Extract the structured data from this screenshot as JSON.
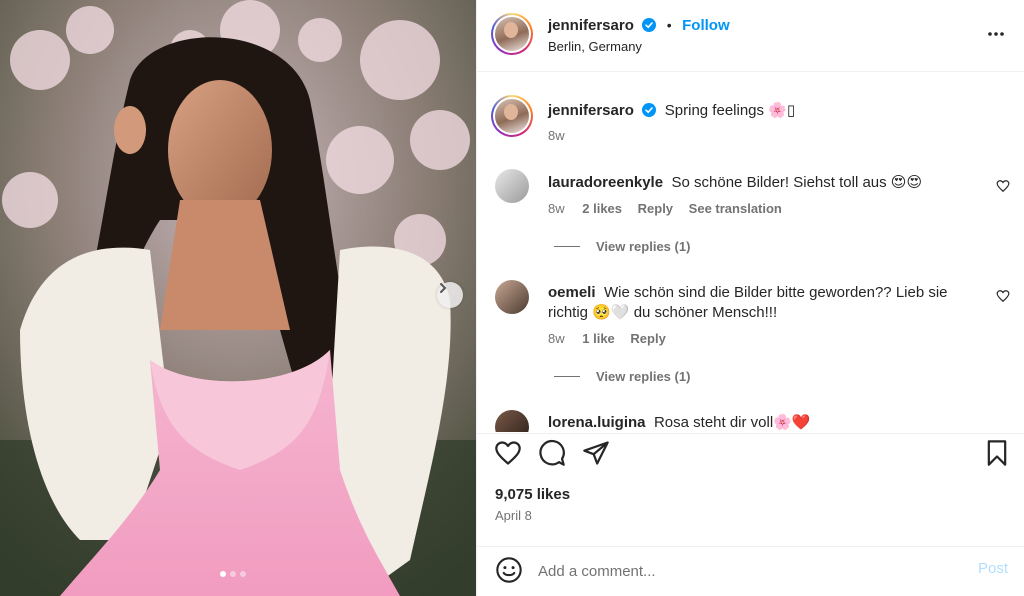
{
  "post": {
    "username": "jennifersaro",
    "follow_label": "Follow",
    "separator": "•",
    "location": "Berlin, Germany",
    "caption": "Spring feelings 🌸▯",
    "caption_time": "8w",
    "likes": "9,075 likes",
    "date": "April 8",
    "carousel": {
      "total": 3,
      "active_index": 1
    }
  },
  "comments": [
    {
      "username": "lauradoreenkyle",
      "text": "So schöne Bilder! Siehst toll aus 😍😍",
      "time": "8w",
      "likes": "2 likes",
      "reply": "Reply",
      "see_translation": "See translation",
      "view_replies": "View replies (1)"
    },
    {
      "username": "oemeli",
      "text": "Wie schön sind die Bilder bitte geworden?? Lieb sie richtig 🥺🤍 du schöner Mensch!!!",
      "time": "8w",
      "likes": "1 like",
      "reply": "Reply",
      "view_replies": "View replies (1)"
    },
    {
      "username": "lorena.luigina",
      "text": "Rosa steht dir voll🌸❤️"
    }
  ],
  "composer": {
    "placeholder": "Add a comment...",
    "post_label": "Post"
  },
  "icons": {
    "verified": "verified-badge-icon",
    "more": "more-options-icon",
    "like": "heart-icon",
    "comment": "comment-bubble-icon",
    "share": "paper-plane-icon",
    "save": "bookmark-icon",
    "emoji": "emoji-smiley-icon",
    "next": "chevron-right-icon"
  },
  "colors": {
    "accent": "#0095f6",
    "post_disabled": "#b2dffc",
    "secondary_text": "#737373"
  }
}
